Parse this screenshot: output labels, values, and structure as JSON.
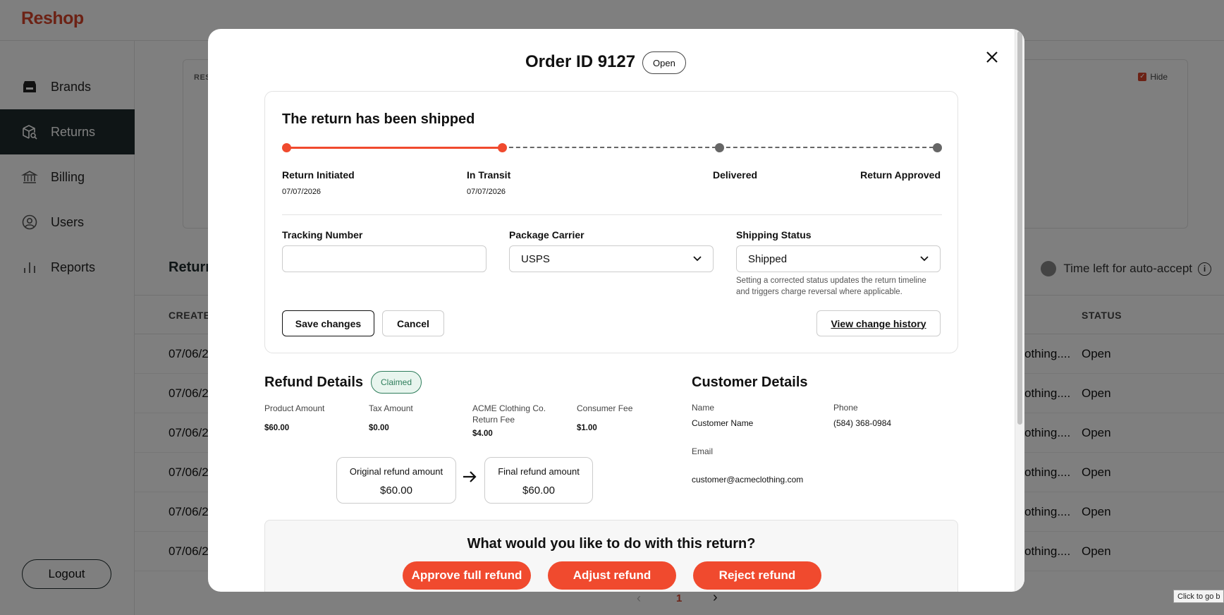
{
  "app": {
    "logo": "Reshop",
    "nav": [
      {
        "label": "Brands",
        "icon": "store-icon"
      },
      {
        "label": "Returns",
        "icon": "package-search-icon",
        "active": true
      },
      {
        "label": "Billing",
        "icon": "bank-icon"
      },
      {
        "label": "Users",
        "icon": "user-circle-icon"
      },
      {
        "label": "Reports",
        "icon": "bar-chart-icon"
      }
    ],
    "logout": "Logout",
    "background": {
      "card_label": "RES",
      "hide_label": "Hide",
      "section_title": "Return",
      "auto_accept": "Time left for auto-accept",
      "col_created": "CREATE",
      "col_status": "STATUS",
      "rows": [
        {
          "created": "07/06/2",
          "item": "othing....",
          "status": "Open"
        },
        {
          "created": "07/06/2",
          "item": "othing....",
          "status": "Open"
        },
        {
          "created": "07/06/2",
          "item": "othing....",
          "status": "Open"
        },
        {
          "created": "07/06/2",
          "item": "othing....",
          "status": "Open"
        },
        {
          "created": "07/06/2",
          "item": "othing....",
          "status": "Open"
        },
        {
          "created": "07/06/2",
          "item": "othing....",
          "status": "Open"
        }
      ],
      "page": "1",
      "tooltip": "Click to go b"
    }
  },
  "modal": {
    "title": "Order ID 9127",
    "status_badge": "Open",
    "shipment": {
      "title": "The return has been shipped",
      "progress_completed_steps": 2,
      "steps": [
        {
          "label": "Return Initiated",
          "date": "07/07/2026"
        },
        {
          "label": "In Transit",
          "date": "07/07/2026"
        },
        {
          "label": "Delivered",
          "date": ""
        },
        {
          "label": "Return Approved",
          "date": ""
        }
      ],
      "tracking_label": "Tracking Number",
      "tracking_value": "",
      "carrier_label": "Package Carrier",
      "carrier_value": "USPS",
      "status_label": "Shipping Status",
      "status_value": "Shipped",
      "status_help": "Setting a corrected status updates the return timeline and triggers charge reversal where applicable.",
      "save_label": "Save changes",
      "cancel_label": "Cancel",
      "history_label": "View change history"
    },
    "refund": {
      "title": "Refund Details",
      "badge": "Claimed",
      "amounts": [
        {
          "label": "Product Amount",
          "value": "$60.00"
        },
        {
          "label": "Tax Amount",
          "value": "$0.00"
        },
        {
          "label": "ACME Clothing Co. Return Fee",
          "value": "$4.00"
        },
        {
          "label": "Consumer Fee",
          "value": "$1.00"
        }
      ],
      "original_label": "Original refund amount",
      "original_value": "$60.00",
      "final_label": "Final refund amount",
      "final_value": "$60.00"
    },
    "customer": {
      "title": "Customer Details",
      "name_label": "Name",
      "name_value": "Customer Name",
      "phone_label": "Phone",
      "phone_value": "(584) 368-0984",
      "email_label": "Email",
      "email_value": "customer@acmeclothing.com"
    },
    "actions": {
      "question": "What would you like to do with this return?",
      "approve": "Approve full refund",
      "adjust": "Adjust refund",
      "reject": "Reject refund"
    }
  },
  "colors": {
    "accent": "#f04a2e",
    "sidebar_active": "#1f2b2c",
    "claimed": "#2e7d5b"
  }
}
